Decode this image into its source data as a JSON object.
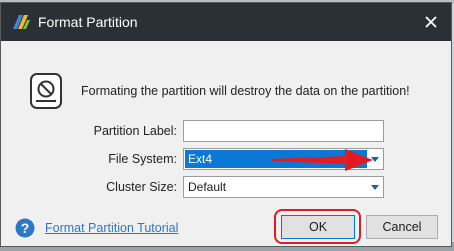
{
  "window": {
    "title": "Format Partition"
  },
  "warning": {
    "text": "Formating the partition will destroy the data on the partition!"
  },
  "form": {
    "partition_label": {
      "label": "Partition Label:",
      "value": ""
    },
    "file_system": {
      "label": "File System:",
      "value": "Ext4"
    },
    "cluster_size": {
      "label": "Cluster Size:",
      "value": "Default"
    }
  },
  "footer": {
    "tutorial_link": "Format Partition Tutorial",
    "ok_label": "OK",
    "cancel_label": "Cancel"
  },
  "colors": {
    "titlebar": "#2b3036",
    "selection": "#0a78d7",
    "annotation_red": "#e11b22",
    "link": "#2a78c7"
  },
  "icons": {
    "app": "app-logo-icon",
    "close": "close-icon",
    "warning": "disk-prohibited-icon",
    "dropdown": "chevron-down-icon",
    "help": "help-icon",
    "annotation": "red-arrow-annotation"
  }
}
